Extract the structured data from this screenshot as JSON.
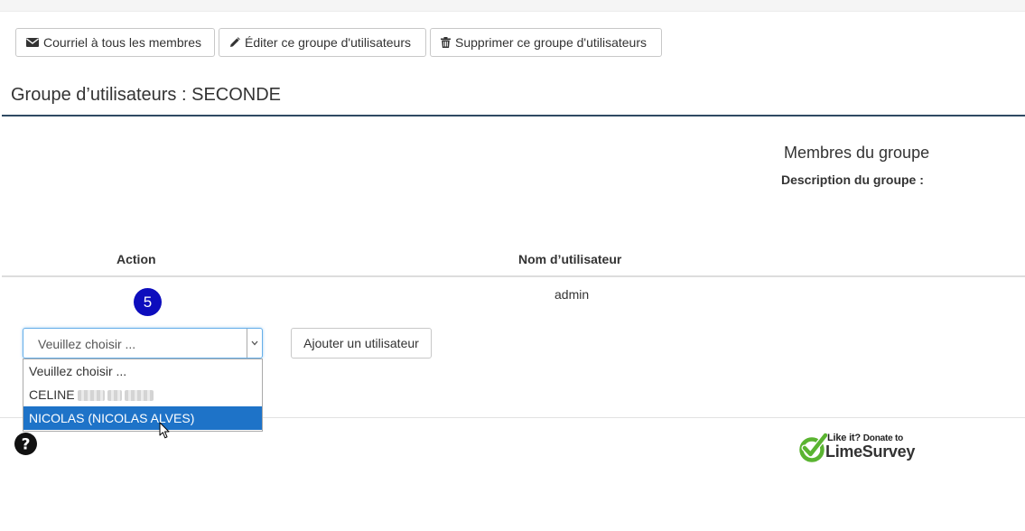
{
  "toolbar": {
    "email_all_label": "Courriel à tous les membres",
    "edit_group_label": "Éditer ce groupe d'utilisateurs",
    "delete_group_label": "Supprimer ce groupe d'utilisateurs"
  },
  "page_title": "Groupe d’utilisateurs : SECONDE",
  "members": {
    "title": "Membres du groupe",
    "description_label": "Description du groupe :"
  },
  "table": {
    "columns": [
      "Action",
      "Nom d’utilisateur"
    ],
    "rows": [
      {
        "badge": "5",
        "username": "admin"
      }
    ]
  },
  "add_user": {
    "select_value": "Veuillez choisir ...",
    "options": [
      "Veuillez choisir ...",
      "CELINE",
      "NICOLAS (NICOLAS ALVES)"
    ],
    "highlighted_option": "NICOLAS (NICOLAS ALVES)",
    "button_label": "Ajouter un utilisateur"
  },
  "footer": {
    "donate_line": "Like it? Donate to",
    "donate_prefix": "Like it?",
    "donate_suffix": "Donate to",
    "brand": "LimeSurvey"
  },
  "colors": {
    "title_rule": "#2f4a63",
    "badge": "#0d0dbd",
    "option_highlight": "#1e73c8",
    "brand_green": "#5ab431"
  },
  "icons": [
    "envelope-icon",
    "pencil-icon",
    "trash-icon",
    "chevron-down-icon",
    "question-circle-icon",
    "mouse-cursor-icon",
    "limesurvey-logo-icon"
  ]
}
